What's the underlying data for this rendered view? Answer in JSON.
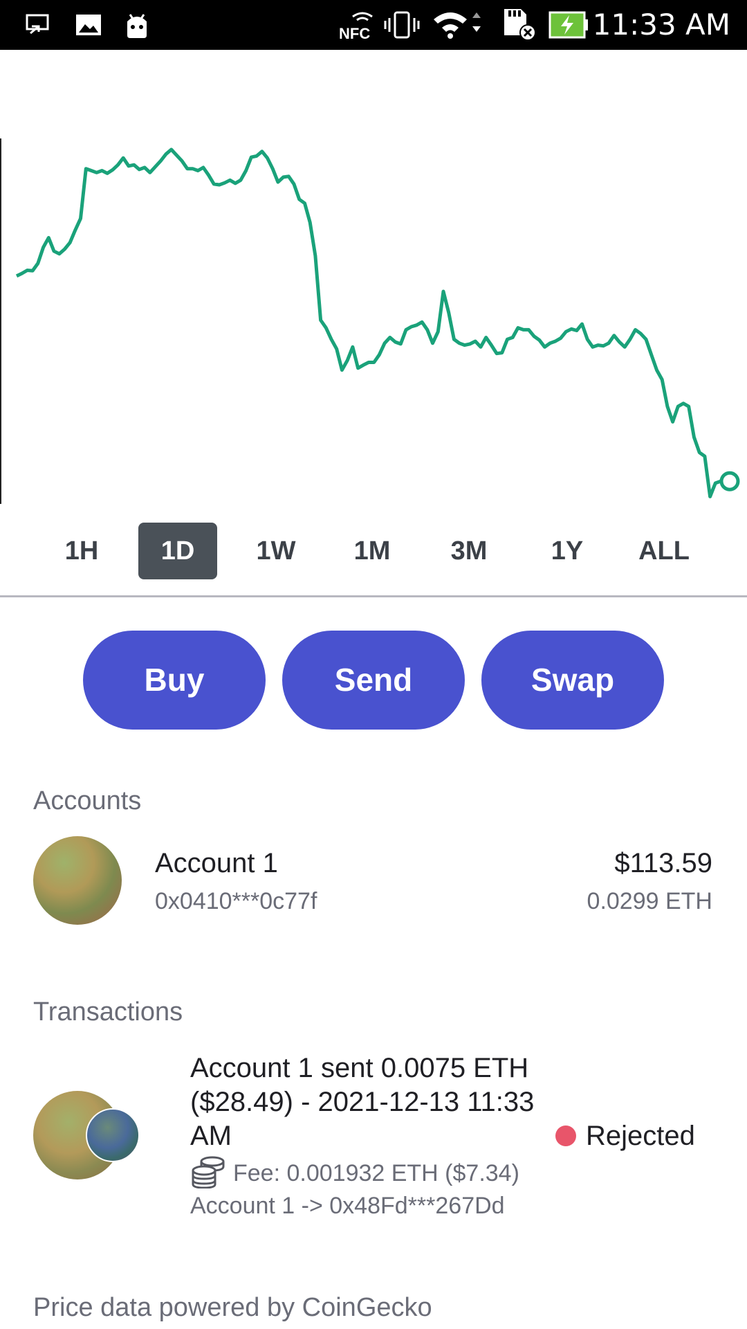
{
  "status_bar": {
    "time": "11:33 AM",
    "icons": [
      "screen-cast-icon",
      "image-icon",
      "android-icon",
      "nfc-icon",
      "vibrate-icon",
      "wifi-icon",
      "sd-card-icon",
      "battery-charging-icon"
    ],
    "nfc_label": "NFC"
  },
  "chart_data": {
    "type": "line",
    "title": "",
    "xlabel": "",
    "ylabel": "",
    "color": "#1aa27a",
    "grid": false,
    "values": [
      60.5,
      61.2,
      62.0,
      61.9,
      63.8,
      68.0,
      70.5,
      67.0,
      66.3,
      67.5,
      69.2,
      72.5,
      75.5,
      88.5,
      88.0,
      87.5,
      88.0,
      87.3,
      88.2,
      89.5,
      91.3,
      89.2,
      89.5,
      88.3,
      88.8,
      87.5,
      89.0,
      90.5,
      92.3,
      93.5,
      92.0,
      90.5,
      88.5,
      88.5,
      88.0,
      88.8,
      86.8,
      84.5,
      84.3,
      84.8,
      85.5,
      84.7,
      85.5,
      88.0,
      91.5,
      91.8,
      93.0,
      91.3,
      88.5,
      85.0,
      86.3,
      86.5,
      84.5,
      80.5,
      79.5,
      74.5,
      65.8,
      49.0,
      47.0,
      44.0,
      41.5,
      36.0,
      38.5,
      42.0,
      36.5,
      37.3,
      38.0,
      38.0,
      40.0,
      43.0,
      44.5,
      43.3,
      42.8,
      46.5,
      47.3,
      47.7,
      48.5,
      46.5,
      43.0,
      46.0,
      56.5,
      51.0,
      44.0,
      43.0,
      42.5,
      42.8,
      43.5,
      42.0,
      44.5,
      42.5,
      40.3,
      40.5,
      44.0,
      44.5,
      47.0,
      46.5,
      46.5,
      44.8,
      43.8,
      42.0,
      43.0,
      43.5,
      44.3,
      46.0,
      46.7,
      46.3,
      48.0,
      44.0,
      42.0,
      42.5,
      42.3,
      43.0,
      45.0,
      43.3,
      42.0,
      44.0,
      46.5,
      45.5,
      44.0,
      40.0,
      36.0,
      33.5,
      26.5,
      22.5,
      26.5,
      27.3,
      26.5,
      18.5,
      14.5,
      13.5,
      3.0,
      6.5,
      7.0
    ],
    "marker_last": true,
    "axis_line": true
  },
  "periods": [
    {
      "label": "1H",
      "active": false
    },
    {
      "label": "1D",
      "active": true
    },
    {
      "label": "1W",
      "active": false
    },
    {
      "label": "1M",
      "active": false
    },
    {
      "label": "3M",
      "active": false
    },
    {
      "label": "1Y",
      "active": false
    },
    {
      "label": "ALL",
      "active": false
    }
  ],
  "actions": {
    "buy": "Buy",
    "send": "Send",
    "swap": "Swap",
    "color": "#4952cf"
  },
  "accounts": {
    "title": "Accounts",
    "items": [
      {
        "name": "Account 1",
        "address": "0x0410***0c77f",
        "usd": "$113.59",
        "eth": "0.0299 ETH"
      }
    ]
  },
  "transactions": {
    "title": "Transactions",
    "items": [
      {
        "description": "Account 1 sent 0.0075 ETH ($28.49) - 2021-12-13 11:33 AM",
        "fee": "Fee: 0.001932 ETH ($7.34)",
        "route": "Account 1 -> 0x48Fd***267Dd",
        "status": "Rejected",
        "status_color": "#e8556a",
        "fee_icon": "coins-icon"
      }
    ]
  },
  "footer": "Price data powered by CoinGecko"
}
